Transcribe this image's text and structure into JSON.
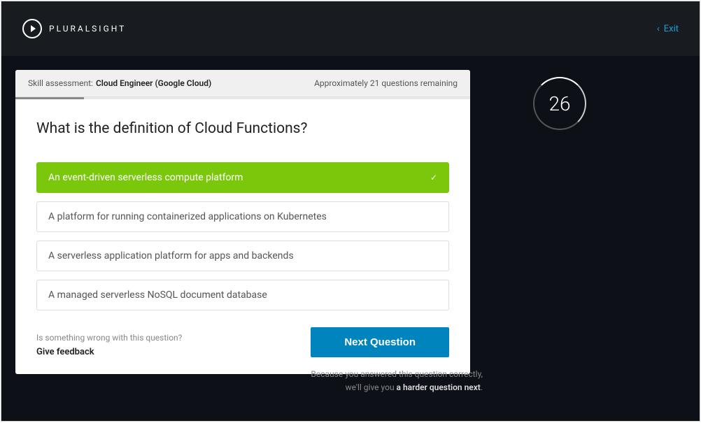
{
  "header": {
    "logo_text": "PLURALSIGHT",
    "exit_label": "Exit"
  },
  "card_header": {
    "label": "Skill assessment:",
    "title": "Cloud Engineer (Google Cloud)",
    "remaining": "Approximately 21 questions remaining"
  },
  "question": {
    "text": "What is the definition of Cloud Functions?",
    "answers": [
      {
        "text": "An event-driven serverless compute platform",
        "selected": true
      },
      {
        "text": "A platform for running containerized applications on Kubernetes",
        "selected": false
      },
      {
        "text": "A serverless application platform for apps and backends",
        "selected": false
      },
      {
        "text": "A managed serverless NoSQL document database",
        "selected": false
      }
    ]
  },
  "feedback": {
    "prompt": "Is something wrong with this question?",
    "link": "Give feedback"
  },
  "next_button": "Next Question",
  "timer": {
    "value": "26"
  },
  "result": {
    "line1": "Because you answered this question correctly,",
    "line2_prefix": "we'll give you ",
    "line2_highlight": "a harder question next",
    "line2_suffix": "."
  }
}
